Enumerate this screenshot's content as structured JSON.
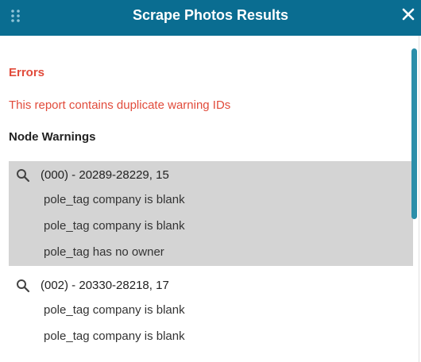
{
  "dialog": {
    "title": "Scrape Photos Results"
  },
  "errors": {
    "heading": "Errors",
    "message": "This report contains duplicate warning IDs"
  },
  "node_warnings": {
    "heading": "Node Warnings",
    "groups": [
      {
        "id": "(000) - 20289-28229, 15",
        "selected": true,
        "warnings": [
          "pole_tag company is blank",
          "pole_tag company is blank",
          "pole_tag has no owner"
        ]
      },
      {
        "id": "(002) - 20330-28218, 17",
        "selected": false,
        "warnings": [
          "pole_tag company is blank",
          "pole_tag company is blank"
        ]
      }
    ]
  },
  "colors": {
    "titlebar": "#0a6d91",
    "error": "#e14b3b",
    "selected_row": "#d4d4d4",
    "scrollbar": "#2b8ea9"
  },
  "icons": {
    "drag": "drag-handle-icon",
    "close": "close-icon",
    "search": "search-icon"
  }
}
